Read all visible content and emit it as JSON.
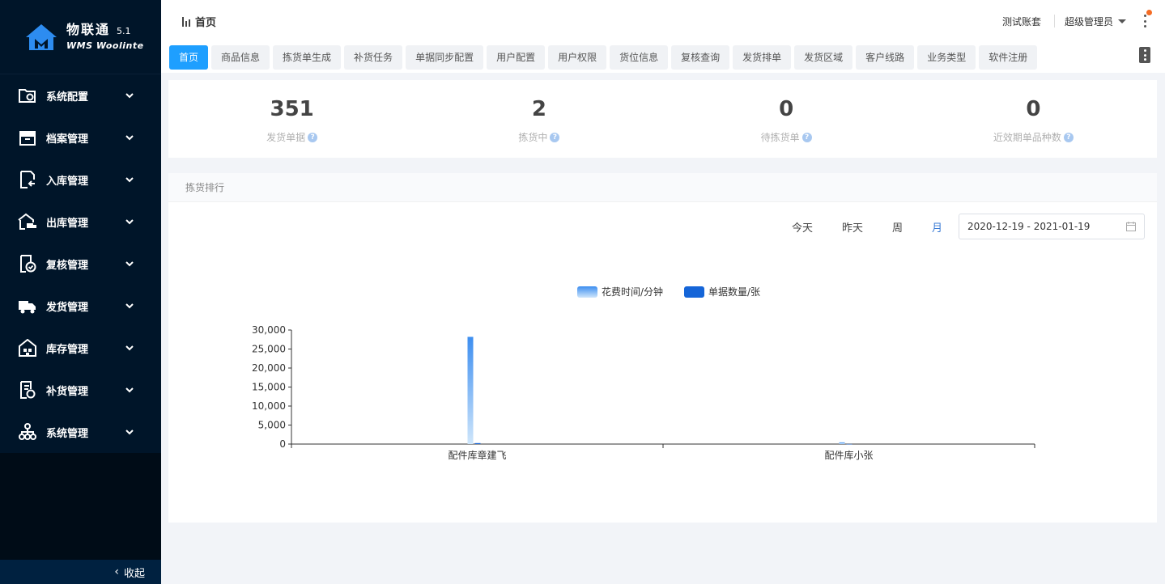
{
  "brand": {
    "title": "物联通",
    "version": "5.1",
    "subtitle": "WMS Woolinte"
  },
  "sidebar": {
    "items": [
      {
        "label": "系统配置",
        "icon": "folder-gear-icon"
      },
      {
        "label": "档案管理",
        "icon": "archive-box-icon"
      },
      {
        "label": "入库管理",
        "icon": "inbound-doc-icon"
      },
      {
        "label": "出库管理",
        "icon": "warehouse-truck-icon"
      },
      {
        "label": "复核管理",
        "icon": "check-doc-icon"
      },
      {
        "label": "发货管理",
        "icon": "delivery-truck-icon"
      },
      {
        "label": "库存管理",
        "icon": "warehouse-icon"
      },
      {
        "label": "补货管理",
        "icon": "replenish-doc-icon"
      },
      {
        "label": "系统管理",
        "icon": "org-tree-icon"
      }
    ],
    "collapse_label": "收起"
  },
  "header": {
    "breadcrumb": "首页",
    "account": "测试账套",
    "user": "超级管理员"
  },
  "tabs": [
    {
      "label": "首页",
      "active": true
    },
    {
      "label": "商品信息"
    },
    {
      "label": "拣货单生成"
    },
    {
      "label": "补货任务"
    },
    {
      "label": "单据同步配置"
    },
    {
      "label": "用户配置"
    },
    {
      "label": "用户权限"
    },
    {
      "label": "货位信息"
    },
    {
      "label": "复核查询"
    },
    {
      "label": "发货排单"
    },
    {
      "label": "发货区域"
    },
    {
      "label": "客户线路"
    },
    {
      "label": "业务类型"
    },
    {
      "label": "软件注册"
    }
  ],
  "stats": [
    {
      "value": "351",
      "label": "发货单据"
    },
    {
      "value": "2",
      "label": "拣货中"
    },
    {
      "value": "0",
      "label": "待拣货单"
    },
    {
      "value": "0",
      "label": "近效期单品种数"
    }
  ],
  "ranking": {
    "title": "拣货排行",
    "filters": [
      "今天",
      "昨天",
      "周",
      "月"
    ],
    "active_filter": "月",
    "date_range": "2020-12-19 - 2021-01-19"
  },
  "chart_data": {
    "type": "bar",
    "categories": [
      "配件库章建飞",
      "配件库小张"
    ],
    "series": [
      {
        "name": "花费时间/分钟",
        "values": [
          28200,
          450
        ],
        "color": "#5aa3f2"
      },
      {
        "name": "单据数量/张",
        "values": [
          250,
          30
        ],
        "color": "#1565d8"
      }
    ],
    "ylim": [
      0,
      30000
    ],
    "yticks": [
      "0",
      "5,000",
      "10,000",
      "15,000",
      "20,000",
      "25,000",
      "30,000"
    ],
    "legend": "top-center"
  }
}
